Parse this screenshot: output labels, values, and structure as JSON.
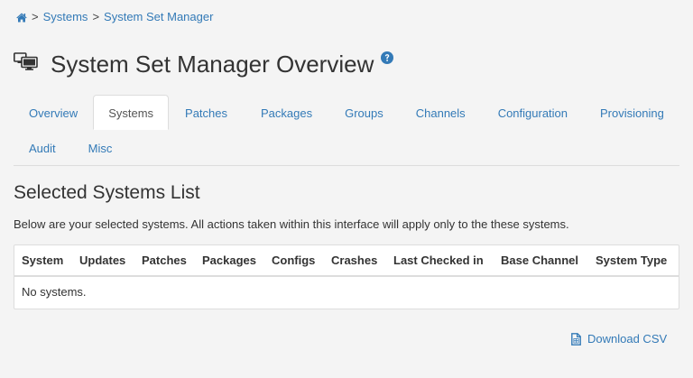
{
  "breadcrumb": {
    "home_icon": "home-icon",
    "separator": ">",
    "items": [
      "Systems",
      "System Set Manager"
    ]
  },
  "page": {
    "title": "System Set Manager Overview",
    "title_icon": "system-set-icon",
    "help_icon": "help-circle-icon"
  },
  "tabs": {
    "row1": [
      "Overview",
      "Systems",
      "Patches",
      "Packages",
      "Groups",
      "Channels",
      "Configuration",
      "Provisioning"
    ],
    "row2": [
      "Audit",
      "Misc"
    ],
    "active": "Systems"
  },
  "section": {
    "title": "Selected Systems List",
    "description": "Below are your selected systems. All actions taken within this interface will apply only to the these systems."
  },
  "table": {
    "columns": [
      "System",
      "Updates",
      "Patches",
      "Packages",
      "Configs",
      "Crashes",
      "Last Checked in",
      "Base Channel",
      "System Type"
    ],
    "empty_message": "No systems."
  },
  "download": {
    "label": "Download CSV",
    "icon": "csv-file-icon"
  },
  "colors": {
    "link": "#337ab7",
    "background": "#f4f4f4",
    "border": "#dddddd"
  }
}
